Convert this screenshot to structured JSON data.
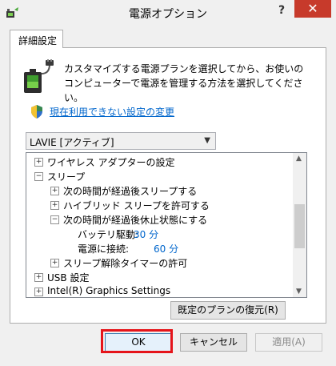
{
  "window": {
    "title": "電源オプション",
    "help_label": "?",
    "close_label": "✕"
  },
  "tab": {
    "label": "詳細設定"
  },
  "description": "カスタマイズする電源プランを選択してから、お使いのコンピューターで電源を管理する方法を選択してください。",
  "link": {
    "label": "現在利用できない設定の変更"
  },
  "plan_select": {
    "value": "LAVIE [アクティブ]"
  },
  "tree": {
    "items": [
      {
        "expander": "+",
        "label": "ワイヤレス アダプターの設定"
      },
      {
        "expander": "−",
        "label": "スリープ"
      },
      {
        "expander": "+",
        "label": "次の時間が経過後スリープする"
      },
      {
        "expander": "+",
        "label": "ハイブリッド スリープを許可する"
      },
      {
        "expander": "−",
        "label": "次の時間が経過後休止状態にする"
      },
      {
        "label": "バッテリ駆動:",
        "value": "30 分"
      },
      {
        "label": "電源に接続:",
        "value": "60 分"
      },
      {
        "expander": "+",
        "label": "スリープ解除タイマーの許可"
      },
      {
        "expander": "+",
        "label": "USB 設定"
      },
      {
        "expander": "+",
        "label": "Intel(R) Graphics Settings"
      }
    ]
  },
  "buttons": {
    "restore": "既定のプランの復元(R)",
    "ok": "OK",
    "cancel": "キャンセル",
    "apply": "適用(A)"
  },
  "colors": {
    "close_button": "#c73a2b",
    "link": "#0066cc",
    "highlight": "#e5141a"
  }
}
